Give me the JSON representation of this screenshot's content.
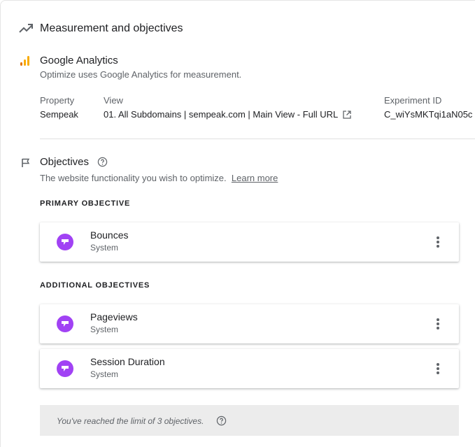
{
  "measurement": {
    "title": "Measurement and objectives",
    "icon": "trending-up-icon"
  },
  "analytics": {
    "title": "Google Analytics",
    "description": "Optimize uses Google Analytics for measurement.",
    "icon": "analytics-bars-icon",
    "brand_colors": [
      "#f9ab00",
      "#e37400"
    ],
    "property_label": "Property",
    "property_value": "Sempeak",
    "view_label": "View",
    "view_value": "01. All Subdomains | sempeak.com | Main View - Full URL",
    "experiment_label": "Experiment ID",
    "experiment_value": "C_wiYsMKTqi1aN05c"
  },
  "objectives": {
    "title": "Objectives",
    "description": "The website functionality you wish to optimize.",
    "learn_more": "Learn more",
    "primary_heading": "PRIMARY OBJECTIVE",
    "additional_heading": "ADDITIONAL OBJECTIVES",
    "icon_color": "#a142f4",
    "primary": {
      "name": "Bounces",
      "source": "System"
    },
    "additional": [
      {
        "name": "Pageviews",
        "source": "System"
      },
      {
        "name": "Session Duration",
        "source": "System"
      }
    ],
    "limit_message": "You've reached the limit of 3 objectives."
  }
}
